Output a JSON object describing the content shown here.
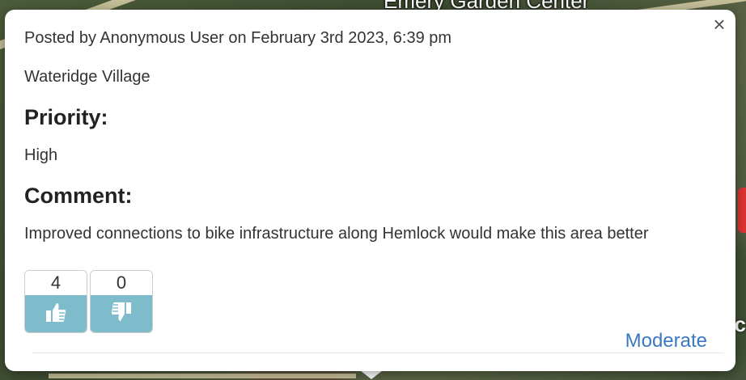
{
  "map": {
    "label": "Emery Garden Center"
  },
  "popup": {
    "close_label": "×",
    "meta": "Posted by Anonymous User on February 3rd 2023, 6:39 pm",
    "location": "Wateridge Village",
    "priority_heading": "Priority:",
    "priority_value": "High",
    "comment_heading": "Comment:",
    "comment_text": "Improved connections to bike infrastructure along Hemlock would make this area better",
    "votes": {
      "up_count": "4",
      "down_count": "0"
    },
    "moderate_label": "Moderate"
  },
  "colors": {
    "vote_bg": "#7fbccb",
    "link": "#3a78c2"
  },
  "icons": {
    "close": "close-icon",
    "upvote": "thumbs-up-icon",
    "downvote": "thumbs-down-icon"
  }
}
